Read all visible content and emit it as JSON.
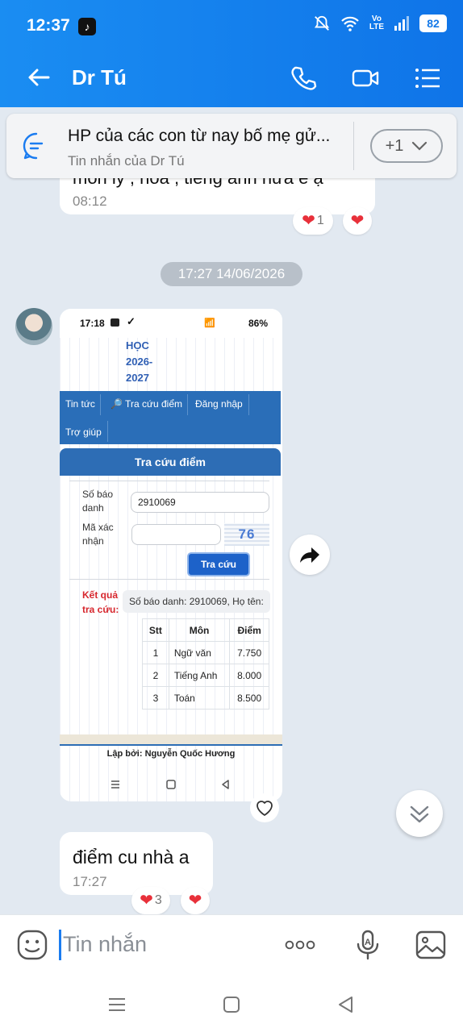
{
  "status_bar": {
    "time": "12:37",
    "battery": "82",
    "volte": "Vo\nLTE"
  },
  "header": {
    "title": "Dr Tú"
  },
  "pinned": {
    "title": "HP của các con từ nay bố mẹ gử...",
    "subtitle": "Tin nhắn của Dr Tú",
    "more_label": "+1"
  },
  "messages": {
    "partial": {
      "text": "môn lý , hoá , tiếng anh nữa e ạ",
      "time": "08:12",
      "reaction_count": "1"
    },
    "date_separator": "17:27 14/06/2026",
    "image_msg": {
      "shot_time": "17:18",
      "shot_battery": "86%",
      "heading_line1": "HỌC",
      "heading_line2": "2026-",
      "heading_line3": "2027",
      "nav": [
        "Tin tức",
        "🔎 Tra cứu điểm",
        "Đăng nhập",
        "Trợ giúp"
      ],
      "panel_title": "Tra cứu điểm",
      "sbd_label_1": "Số báo",
      "sbd_label_2": "danh",
      "sbd_value": "2910069",
      "captcha_label_1": "Mã xác",
      "captcha_label_2": "nhận",
      "captcha_code": "76",
      "submit": "Tra cứu",
      "result_label_1": "Kết quả",
      "result_label_2": "tra cứu:",
      "result_text": "Số báo danh: 2910069, Họ tên:",
      "table_headers": [
        "Stt",
        "Môn",
        "Điểm"
      ],
      "rows": [
        [
          "1",
          "Ngữ văn",
          "7.750"
        ],
        [
          "2",
          "Tiếng Anh",
          "8.000"
        ],
        [
          "3",
          "Toán",
          "8.500"
        ]
      ],
      "footer": "Lập bởi: Nguyễn Quốc Hương"
    },
    "last": {
      "text": "điểm cu nhà a",
      "time": "17:27",
      "reaction_count": "3"
    }
  },
  "input": {
    "placeholder": "Tin nhắn"
  },
  "colors": {
    "header": "#1582ee",
    "heart": "#e8303a",
    "accent": "#1b7cf0"
  }
}
